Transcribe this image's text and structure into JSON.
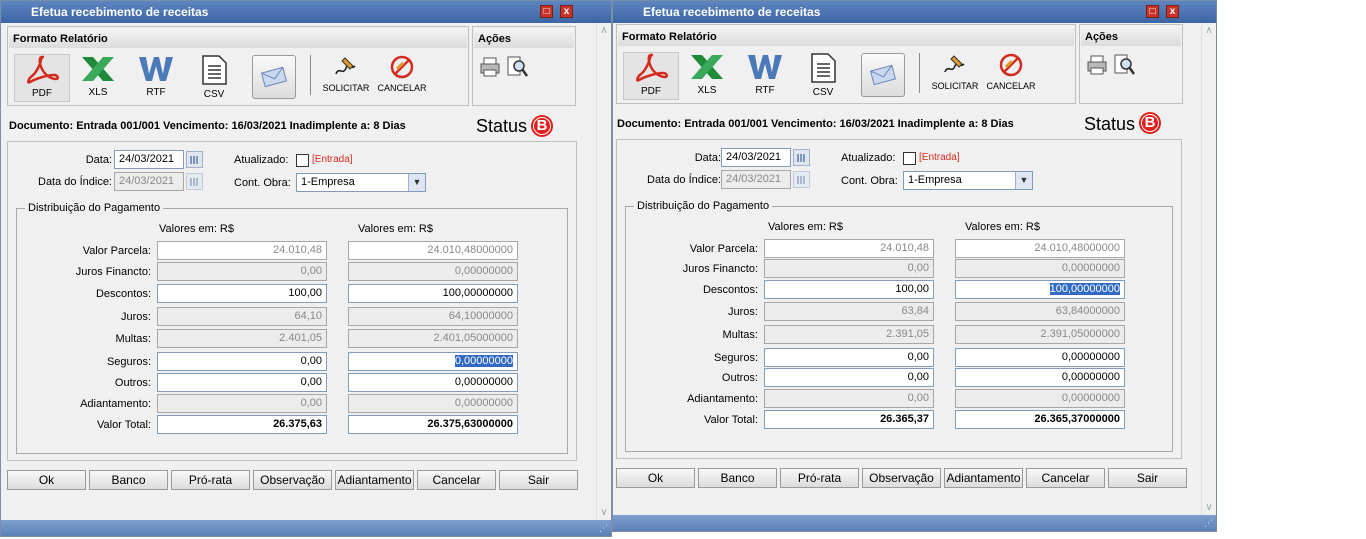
{
  "windows": [
    {
      "title": "Efetua recebimento de receitas",
      "format_header": "Formato Relatório",
      "actions_header": "Ações",
      "formats": [
        "PDF",
        "XLS",
        "RTF",
        "CSV"
      ],
      "solicitar": "SOLICITAR",
      "cancelar": "CANCELAR",
      "document_line": "Documento: Entrada 001/001 Vencimento: 16/03/2021 Inadimplente a: 8 Dias",
      "status_label": "Status",
      "status_badge": "B",
      "data_label": "Data:",
      "data_value": "24/03/2021",
      "data_indice_label": "Data do Índice:",
      "data_indice_value": "24/03/2021",
      "atualizado_label": "Atualizado:",
      "entrada_label": "[Entrada]",
      "cont_obra_label": "Cont. Obra:",
      "cont_obra_value": "1-Empresa",
      "distribuicao_label": "Distribuição do Pagamento",
      "valores_header_1": "Valores em: R$",
      "valores_header_2": "Valores em: R$",
      "rows": [
        {
          "label": "Valor Parcela:",
          "v1": "24.010,48",
          "v2": "24.010,48000000"
        },
        {
          "label": "Juros Financto:",
          "v1": "0,00",
          "v2": "0,00000000"
        },
        {
          "label": "Descontos:",
          "v1": "100,00",
          "v2": "100,00000000"
        },
        {
          "label": "Juros:",
          "v1": "64,10",
          "v2": "64,10000000"
        },
        {
          "label": "Multas:",
          "v1": "2.401,05",
          "v2": "2.401,05000000"
        },
        {
          "label": "Seguros:",
          "v1": "0,00",
          "v2": "0,00000000"
        },
        {
          "label": "Outros:",
          "v1": "0,00",
          "v2": "0,00000000"
        },
        {
          "label": "Adiantamento:",
          "v1": "0,00",
          "v2": "0,00000000"
        },
        {
          "label": "Valor Total:",
          "v1": "26.375,63",
          "v2": "26.375,63000000"
        }
      ],
      "buttons": [
        "Ok",
        "Banco",
        "Pró-rata",
        "Observação",
        "Adiantamento",
        "Cancelar",
        "Sair"
      ]
    },
    {
      "title": "Efetua recebimento de receitas",
      "format_header": "Formato Relatório",
      "actions_header": "Ações",
      "formats": [
        "PDF",
        "XLS",
        "RTF",
        "CSV"
      ],
      "solicitar": "SOLICITAR",
      "cancelar": "CANCELAR",
      "document_line": "Documento: Entrada 001/001 Vencimento: 16/03/2021 Inadimplente a: 8 Dias",
      "status_label": "Status",
      "status_badge": "B",
      "data_label": "Data:",
      "data_value": "24/03/2021",
      "data_indice_label": "Data do Índice:",
      "data_indice_value": "24/03/2021",
      "atualizado_label": "Atualizado:",
      "entrada_label": "[Entrada]",
      "cont_obra_label": "Cont. Obra:",
      "cont_obra_value": "1-Empresa",
      "distribuicao_label": "Distribuição do Pagamento",
      "valores_header_1": "Valores em: R$",
      "valores_header_2": "Valores em: R$",
      "rows": [
        {
          "label": "Valor Parcela:",
          "v1": "24.010,48",
          "v2": "24.010,48000000"
        },
        {
          "label": "Juros Financto:",
          "v1": "0,00",
          "v2": "0,00000000"
        },
        {
          "label": "Descontos:",
          "v1": "100,00",
          "v2": "100,00000000"
        },
        {
          "label": "Juros:",
          "v1": "63,84",
          "v2": "63,84000000"
        },
        {
          "label": "Multas:",
          "v1": "2.391,05",
          "v2": "2.391,05000000"
        },
        {
          "label": "Seguros:",
          "v1": "0,00",
          "v2": "0,00000000"
        },
        {
          "label": "Outros:",
          "v1": "0,00",
          "v2": "0,00000000"
        },
        {
          "label": "Adiantamento:",
          "v1": "0,00",
          "v2": "0,00000000"
        },
        {
          "label": "Valor Total:",
          "v1": "26.365,37",
          "v2": "26.365,37000000"
        }
      ],
      "buttons": [
        "Ok",
        "Banco",
        "Pró-rata",
        "Observação",
        "Adiantamento",
        "Cancelar",
        "Sair"
      ]
    }
  ]
}
